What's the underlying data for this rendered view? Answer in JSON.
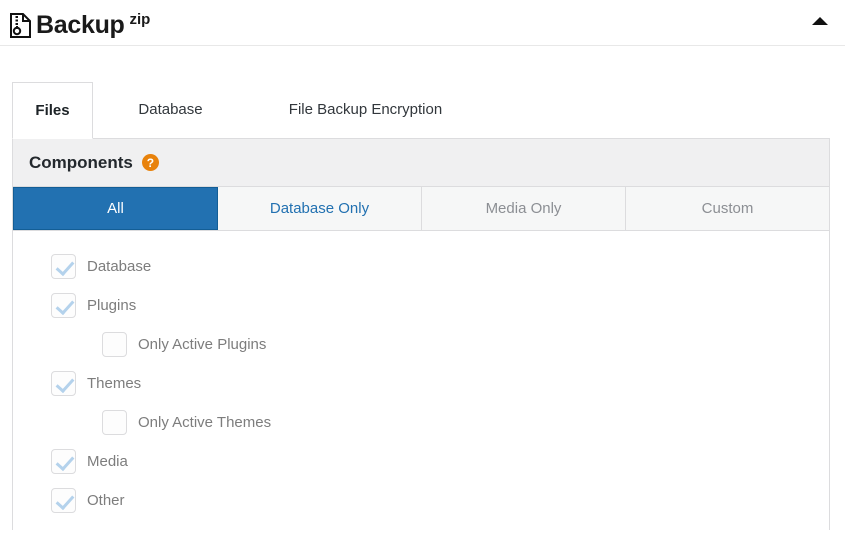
{
  "header": {
    "brand_name": "Backup",
    "brand_superscript": "zip",
    "logo_icon": "zip-file-icon",
    "collapse_icon": "triangle-up-icon"
  },
  "tabs": [
    {
      "label": "Files",
      "active": true
    },
    {
      "label": "Database",
      "active": false
    },
    {
      "label": "File Backup Encryption",
      "active": false
    }
  ],
  "panel": {
    "title": "Components",
    "help_icon": "question-mark-icon",
    "help_glyph": "?",
    "segmented": [
      {
        "label": "All",
        "state": "selected"
      },
      {
        "label": "Database Only",
        "state": "enabled"
      },
      {
        "label": "Media Only",
        "state": "disabled"
      },
      {
        "label": "Custom",
        "state": "disabled"
      }
    ],
    "components": [
      {
        "label": "Database",
        "checked": true,
        "indented": false
      },
      {
        "label": "Plugins",
        "checked": true,
        "indented": false
      },
      {
        "label": "Only Active Plugins",
        "checked": false,
        "indented": true
      },
      {
        "label": "Themes",
        "checked": true,
        "indented": false
      },
      {
        "label": "Only Active Themes",
        "checked": false,
        "indented": true
      },
      {
        "label": "Media",
        "checked": true,
        "indented": false
      },
      {
        "label": "Other",
        "checked": true,
        "indented": false
      }
    ]
  },
  "colors": {
    "accent_blue": "#2271b1",
    "accent_blue_border": "#135e96",
    "help_orange": "#e8820c",
    "check_blue": "#b4d2ec",
    "panel_head_bg": "#f0f0f1",
    "border": "#dcdcde",
    "label_gray": "#7d7d7d",
    "disabled_gray": "#8c8f94"
  }
}
